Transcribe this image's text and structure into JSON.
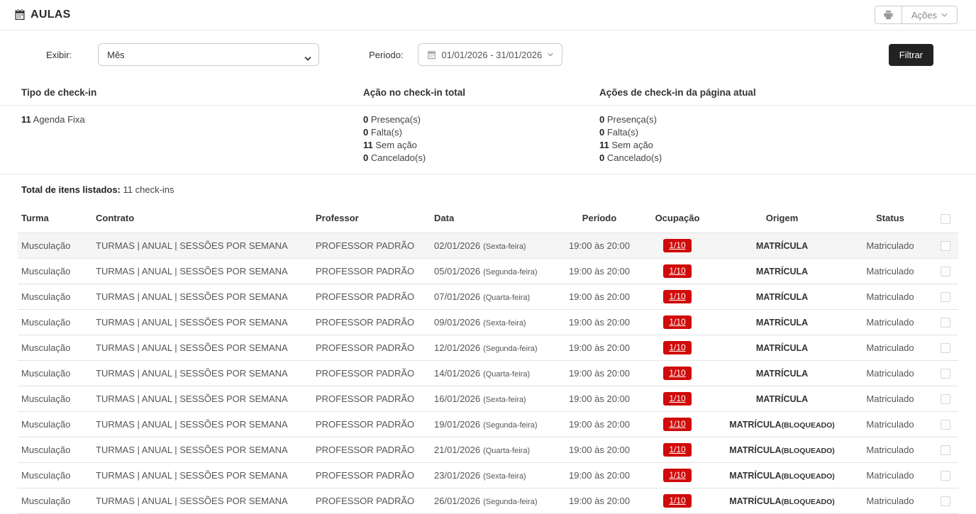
{
  "header": {
    "title": "AULAS",
    "actions_label": "Ações"
  },
  "filters": {
    "exibir_label": "Exibir:",
    "exibir_value": "Mês",
    "periodo_label": "Periodo:",
    "periodo_value": "01/01/2026 - 31/01/2026",
    "filter_button": "Filtrar"
  },
  "summary": {
    "columns": [
      {
        "title": "Tipo de check-in",
        "items": [
          {
            "count": "11",
            "label": "Agenda Fixa"
          }
        ]
      },
      {
        "title": "Ação no check-in total",
        "items": [
          {
            "count": "0",
            "label": "Presença(s)"
          },
          {
            "count": "0",
            "label": "Falta(s)"
          },
          {
            "count": "11",
            "label": "Sem ação"
          },
          {
            "count": "0",
            "label": "Cancelado(s)"
          }
        ]
      },
      {
        "title": "Ações de check-in da página atual",
        "items": [
          {
            "count": "0",
            "label": "Presença(s)"
          },
          {
            "count": "0",
            "label": "Falta(s)"
          },
          {
            "count": "11",
            "label": "Sem ação"
          },
          {
            "count": "0",
            "label": "Cancelado(s)"
          }
        ]
      }
    ]
  },
  "total": {
    "label": "Total de itens listados:",
    "value": "11 check-ins"
  },
  "table": {
    "headers": [
      "Turma",
      "Contrato",
      "Professor",
      "Data",
      "Período",
      "Ocupação",
      "Origem",
      "Status"
    ],
    "rows": [
      {
        "turma": "Musculação",
        "contrato": "TURMAS | ANUAL | SESSÕES POR SEMANA",
        "professor": "PROFESSOR PADRÃO",
        "data": "02/01/2026",
        "dia": "(Sexta-feira)",
        "periodo": "19:00 às 20:00",
        "ocupacao": "1/10",
        "origem": "MATRÍCULA",
        "origem_extra": "",
        "status": "Matriculado"
      },
      {
        "turma": "Musculação",
        "contrato": "TURMAS | ANUAL | SESSÕES POR SEMANA",
        "professor": "PROFESSOR PADRÃO",
        "data": "05/01/2026",
        "dia": "(Segunda-feira)",
        "periodo": "19:00 às 20:00",
        "ocupacao": "1/10",
        "origem": "MATRÍCULA",
        "origem_extra": "",
        "status": "Matriculado"
      },
      {
        "turma": "Musculação",
        "contrato": "TURMAS | ANUAL | SESSÕES POR SEMANA",
        "professor": "PROFESSOR PADRÃO",
        "data": "07/01/2026",
        "dia": "(Quarta-feira)",
        "periodo": "19:00 às 20:00",
        "ocupacao": "1/10",
        "origem": "MATRÍCULA",
        "origem_extra": "",
        "status": "Matriculado"
      },
      {
        "turma": "Musculação",
        "contrato": "TURMAS | ANUAL | SESSÕES POR SEMANA",
        "professor": "PROFESSOR PADRÃO",
        "data": "09/01/2026",
        "dia": "(Sexta-feira)",
        "periodo": "19:00 às 20:00",
        "ocupacao": "1/10",
        "origem": "MATRÍCULA",
        "origem_extra": "",
        "status": "Matriculado"
      },
      {
        "turma": "Musculação",
        "contrato": "TURMAS | ANUAL | SESSÕES POR SEMANA",
        "professor": "PROFESSOR PADRÃO",
        "data": "12/01/2026",
        "dia": "(Segunda-feira)",
        "periodo": "19:00 às 20:00",
        "ocupacao": "1/10",
        "origem": "MATRÍCULA",
        "origem_extra": "",
        "status": "Matriculado"
      },
      {
        "turma": "Musculação",
        "contrato": "TURMAS | ANUAL | SESSÕES POR SEMANA",
        "professor": "PROFESSOR PADRÃO",
        "data": "14/01/2026",
        "dia": "(Quarta-feira)",
        "periodo": "19:00 às 20:00",
        "ocupacao": "1/10",
        "origem": "MATRÍCULA",
        "origem_extra": "",
        "status": "Matriculado"
      },
      {
        "turma": "Musculação",
        "contrato": "TURMAS | ANUAL | SESSÕES POR SEMANA",
        "professor": "PROFESSOR PADRÃO",
        "data": "16/01/2026",
        "dia": "(Sexta-feira)",
        "periodo": "19:00 às 20:00",
        "ocupacao": "1/10",
        "origem": "MATRÍCULA",
        "origem_extra": "",
        "status": "Matriculado"
      },
      {
        "turma": "Musculação",
        "contrato": "TURMAS | ANUAL | SESSÕES POR SEMANA",
        "professor": "PROFESSOR PADRÃO",
        "data": "19/01/2026",
        "dia": "(Segunda-feira)",
        "periodo": "19:00 às 20:00",
        "ocupacao": "1/10",
        "origem": "MATRÍCULA",
        "origem_extra": "(BLOQUEADO)",
        "status": "Matriculado"
      },
      {
        "turma": "Musculação",
        "contrato": "TURMAS | ANUAL | SESSÕES POR SEMANA",
        "professor": "PROFESSOR PADRÃO",
        "data": "21/01/2026",
        "dia": "(Quarta-feira)",
        "periodo": "19:00 às 20:00",
        "ocupacao": "1/10",
        "origem": "MATRÍCULA",
        "origem_extra": "(BLOQUEADO)",
        "status": "Matriculado"
      },
      {
        "turma": "Musculação",
        "contrato": "TURMAS | ANUAL | SESSÕES POR SEMANA",
        "professor": "PROFESSOR PADRÃO",
        "data": "23/01/2026",
        "dia": "(Sexta-feira)",
        "periodo": "19:00 às 20:00",
        "ocupacao": "1/10",
        "origem": "MATRÍCULA",
        "origem_extra": "(BLOQUEADO)",
        "status": "Matriculado"
      },
      {
        "turma": "Musculação",
        "contrato": "TURMAS | ANUAL | SESSÕES POR SEMANA",
        "professor": "PROFESSOR PADRÃO",
        "data": "26/01/2026",
        "dia": "(Segunda-feira)",
        "periodo": "19:00 às 20:00",
        "ocupacao": "1/10",
        "origem": "MATRÍCULA",
        "origem_extra": "(BLOQUEADO)",
        "status": "Matriculado"
      }
    ]
  },
  "colors": {
    "badge_red": "#d10a0a",
    "filter_button_bg": "#222222",
    "row_highlight": "#f5f5f5"
  }
}
